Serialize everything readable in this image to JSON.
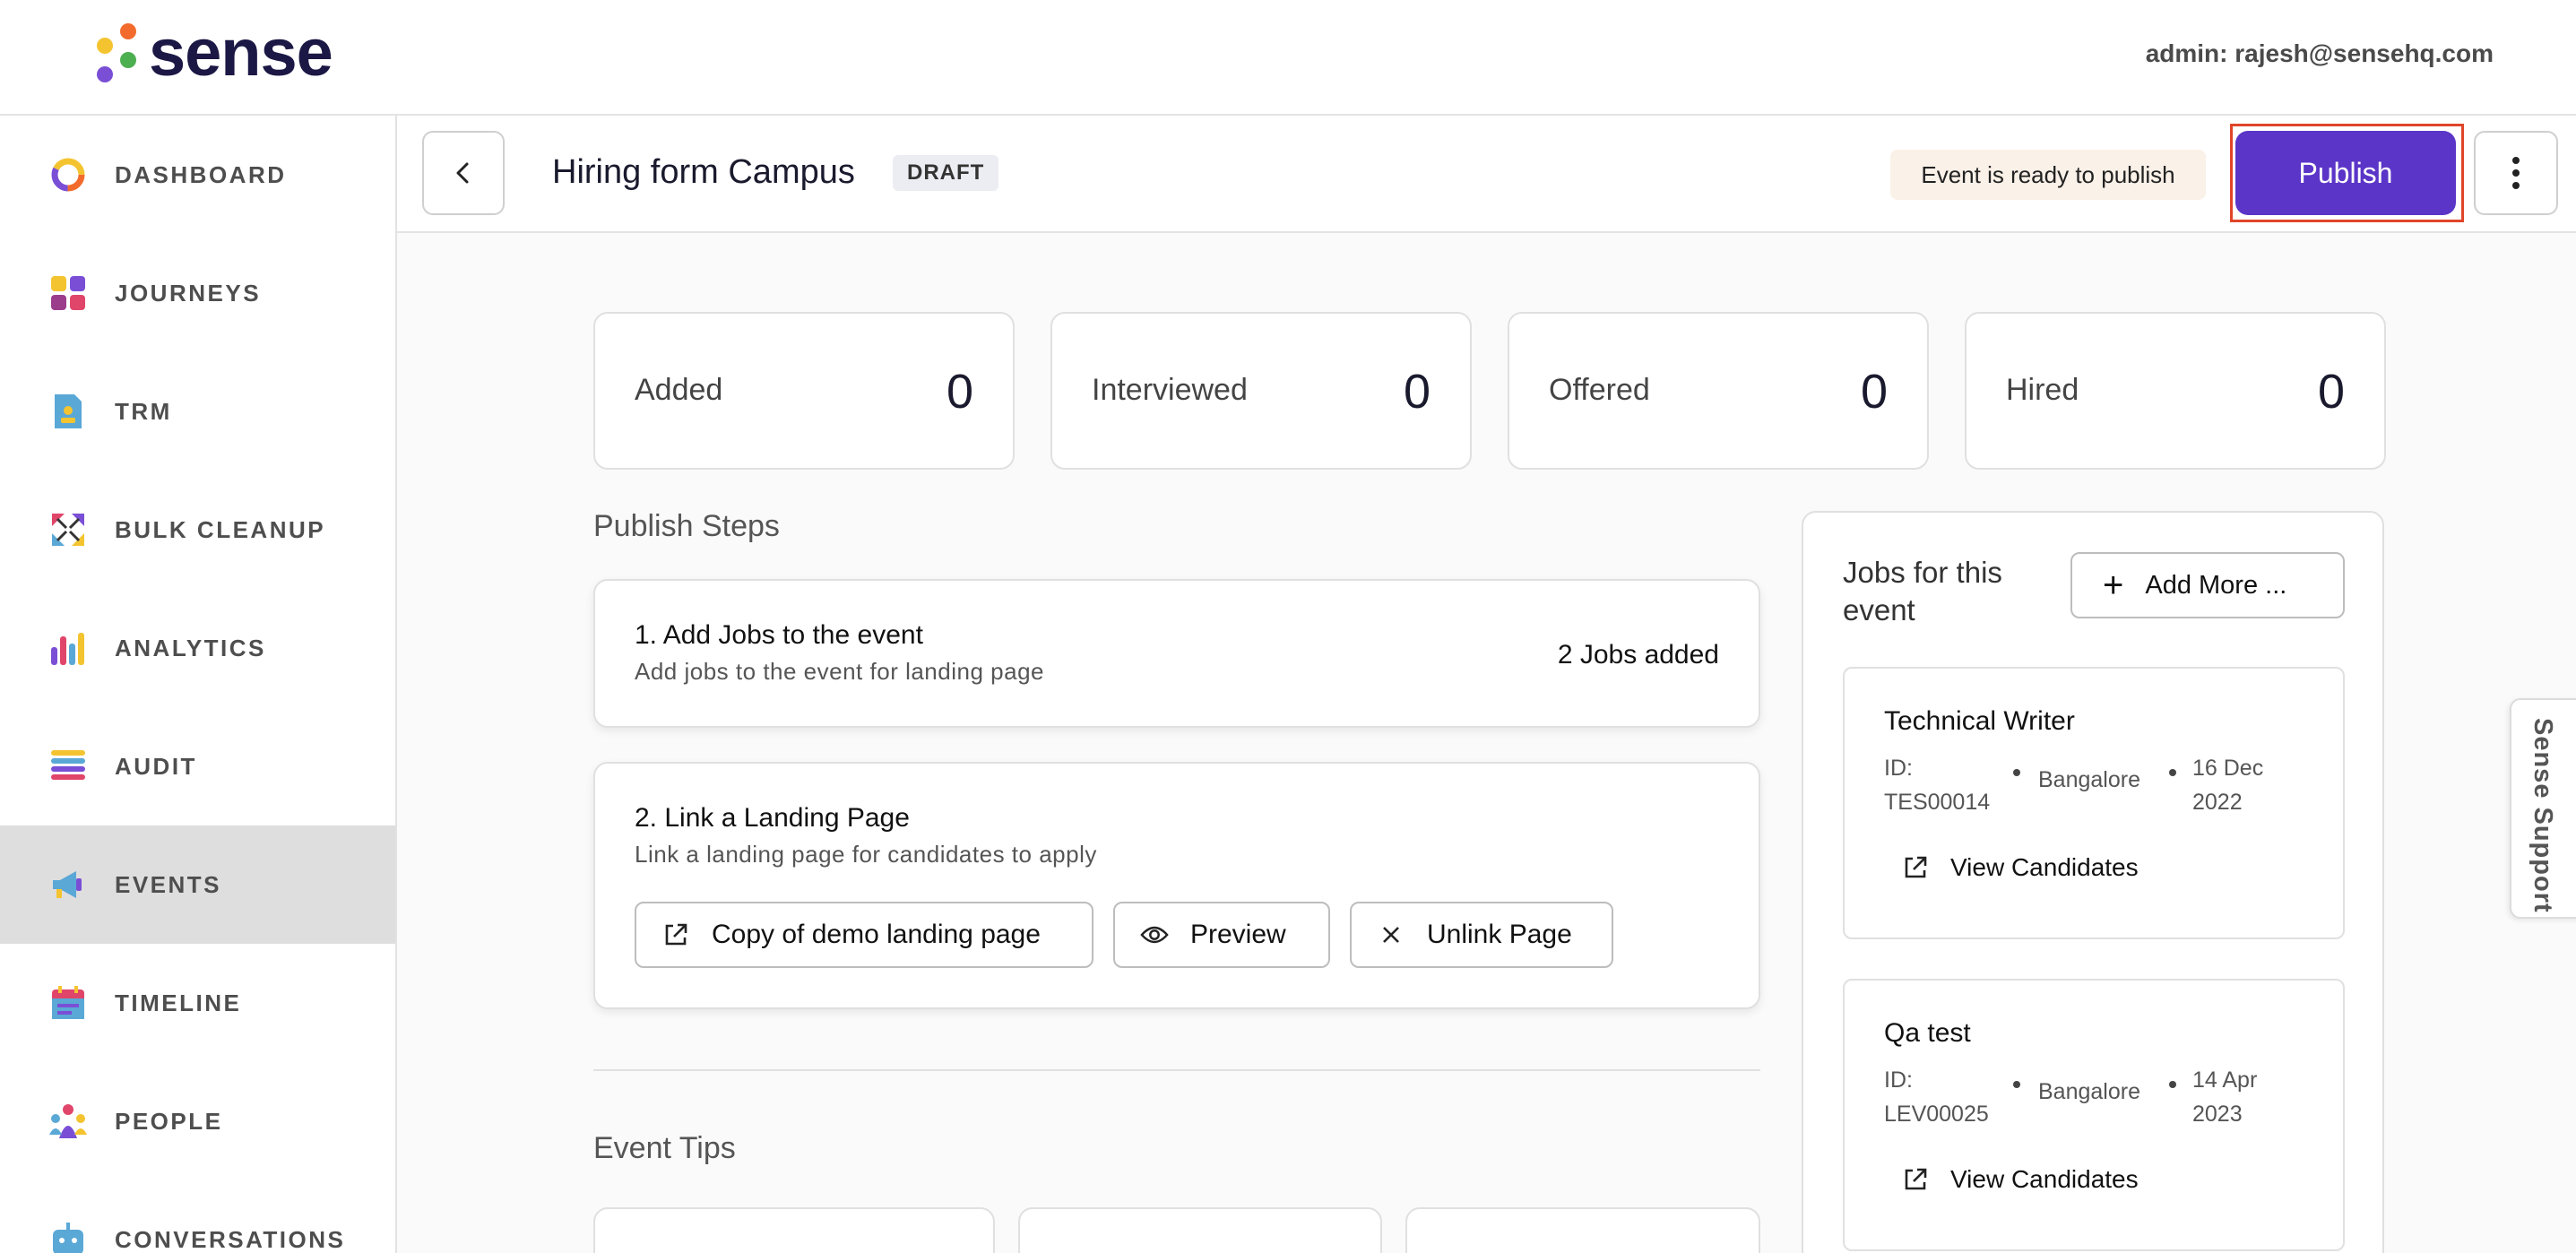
{
  "header": {
    "logo_text": "sense",
    "admin_label": "admin: rajesh@sensehq.com"
  },
  "sidebar": {
    "items": [
      {
        "label": "DASHBOARD",
        "icon": "dashboard-icon"
      },
      {
        "label": "JOURNEYS",
        "icon": "journeys-icon"
      },
      {
        "label": "TRM",
        "icon": "trm-icon"
      },
      {
        "label": "BULK CLEANUP",
        "icon": "bulk-cleanup-icon"
      },
      {
        "label": "ANALYTICS",
        "icon": "analytics-icon"
      },
      {
        "label": "AUDIT",
        "icon": "audit-icon"
      },
      {
        "label": "EVENTS",
        "icon": "megaphone-icon",
        "active": true
      },
      {
        "label": "TIMELINE",
        "icon": "calendar-icon"
      },
      {
        "label": "PEOPLE",
        "icon": "people-icon"
      },
      {
        "label": "CONVERSATIONS",
        "icon": "chat-bot-icon"
      }
    ]
  },
  "event": {
    "title": "Hiring form Campus",
    "status_badge": "DRAFT",
    "ready_message": "Event is ready to publish",
    "publish_label": "Publish"
  },
  "stats": [
    {
      "label": "Added",
      "value": "0"
    },
    {
      "label": "Interviewed",
      "value": "0"
    },
    {
      "label": "Offered",
      "value": "0"
    },
    {
      "label": "Hired",
      "value": "0"
    }
  ],
  "publish_steps": {
    "title": "Publish Steps",
    "step1": {
      "title": "1. Add Jobs to the event",
      "subtitle": "Add jobs to the event for landing page",
      "status": "2 Jobs added"
    },
    "step2": {
      "title": "2. Link a Landing Page",
      "subtitle": "Link a landing page for candidates to apply",
      "landing_page_label": "Copy of demo landing page",
      "preview_label": "Preview",
      "unlink_label": "Unlink Page"
    }
  },
  "event_tips": {
    "title": "Event Tips"
  },
  "jobs_panel": {
    "title": "Jobs for this event",
    "add_more_label": "Add More ...",
    "jobs": [
      {
        "title": "Technical Writer",
        "id": "ID: TES00014",
        "location": "Bangalore",
        "date": "16 Dec 2022",
        "view_label": "View Candidates"
      },
      {
        "title": "Qa test",
        "id": "ID: LEV00025",
        "location": "Bangalore",
        "date": "14 Apr 2023",
        "view_label": "View Candidates"
      }
    ]
  },
  "support": {
    "label": "Sense Support"
  },
  "colors": {
    "accent": "#5b35c8",
    "logo_text": "#1b1845",
    "highlight_outline": "#e0452a",
    "ready_badge_bg": "#faf1e8"
  }
}
